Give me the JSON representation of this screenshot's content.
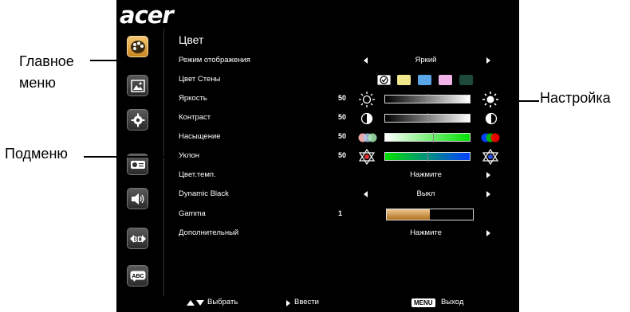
{
  "brand": {
    "logo": "acer"
  },
  "sidebar": {
    "items": [
      {
        "name": "color",
        "icon": "palette-icon",
        "active": true
      },
      {
        "name": "image",
        "icon": "picture-icon",
        "active": false
      },
      {
        "name": "settings",
        "icon": "gear-icon",
        "active": false
      },
      {
        "name": "management",
        "icon": "projector-icon",
        "active": false
      },
      {
        "name": "audio",
        "icon": "speaker-icon",
        "active": false
      },
      {
        "name": "3d",
        "icon": "3d-icon",
        "label": "3D",
        "active": false
      },
      {
        "name": "language",
        "icon": "abc-icon",
        "label": "ABC",
        "active": false
      }
    ]
  },
  "menu": {
    "title": "Цвет",
    "rows": [
      {
        "label": "Режим отображения",
        "value": "Яркий"
      },
      {
        "label": "Цвет Стены"
      },
      {
        "label": "Яркость",
        "number": "50"
      },
      {
        "label": "Контраст",
        "number": "50"
      },
      {
        "label": "Насыщение",
        "number": "50"
      },
      {
        "label": "Уклон",
        "number": "50"
      },
      {
        "label": "Цвет.темп.",
        "value": "Нажмите"
      },
      {
        "label": "Dynamic Black",
        "value": "Выкл"
      },
      {
        "label": "Gamma",
        "number": "1",
        "level": 0.5
      },
      {
        "label": "Дополнительный",
        "value": "Нажмите"
      }
    ],
    "wall_colors": [
      "#f0e88a",
      "#5aa7e8",
      "#f0b4e8",
      "#1d4a3a"
    ]
  },
  "footer": {
    "select_label": "Выбрать",
    "enter_label": "Ввести",
    "menu_key": "MENU",
    "exit_label": "Выход"
  },
  "callouts": {
    "main_menu": "Главное\nменю",
    "main_menu_line1": "Главное",
    "main_menu_line2": "меню",
    "submenu": "Подменю",
    "adjust": "Настройка"
  },
  "colors": {
    "accent": "#e0a040",
    "background": "#000000"
  }
}
